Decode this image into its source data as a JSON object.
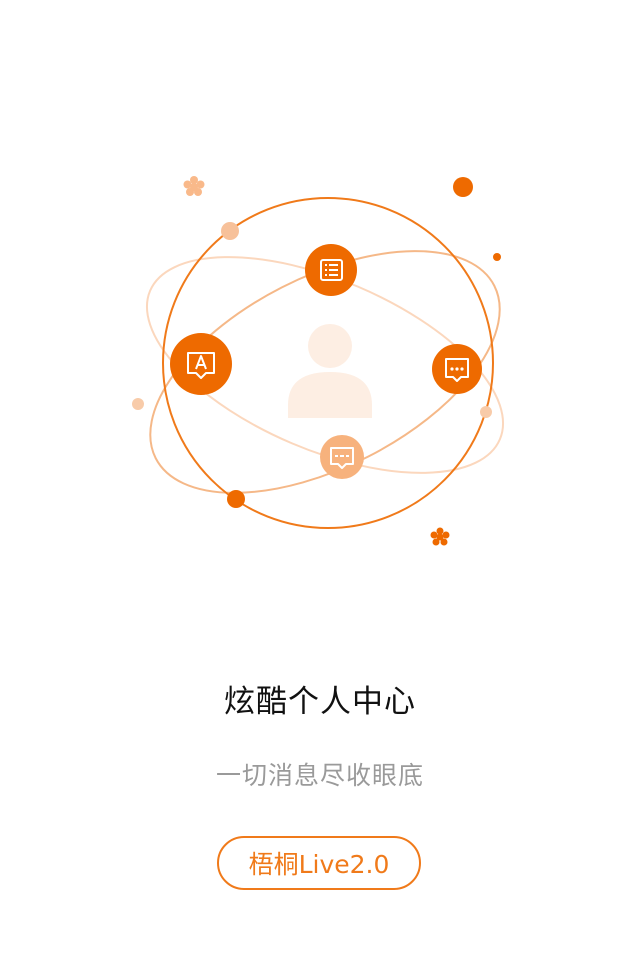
{
  "colors": {
    "accent": "#f07a1a",
    "accent_dark": "#ee6a00",
    "accent_light": "#f7b27d",
    "accent_pale": "#fde9da",
    "title_text": "#111111",
    "subtitle_text": "#9a9a9a"
  },
  "illustration": {
    "center_icon": "user-avatar-icon",
    "orbit_icons": [
      "list-icon",
      "message-dots-icon",
      "subtitle-a-icon",
      "chat-lines-icon"
    ]
  },
  "feature": {
    "title": "炫酷个人中心",
    "subtitle": "一切消息尽收眼底"
  },
  "cta": {
    "label": "梧桐Live2.0"
  }
}
